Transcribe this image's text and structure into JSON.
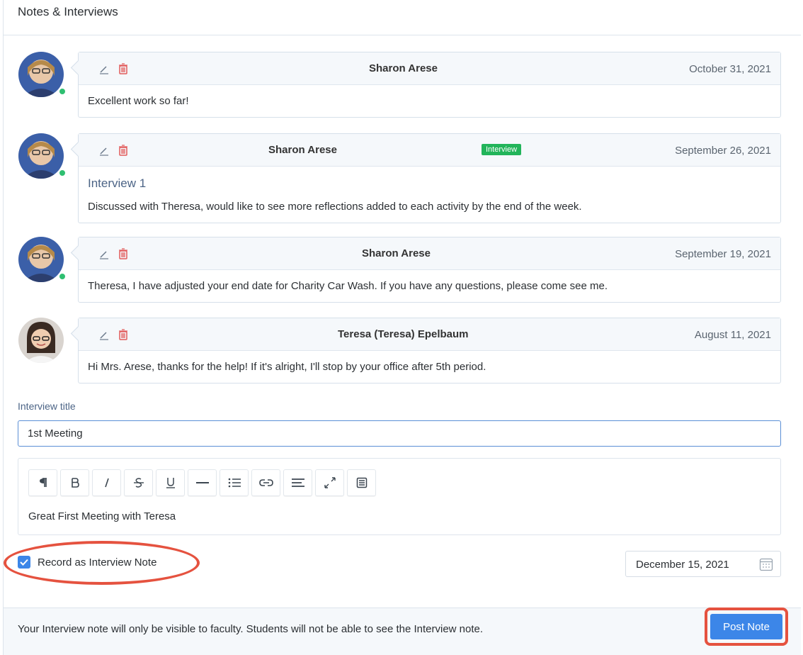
{
  "panel": {
    "title": "Notes & Interviews"
  },
  "notes": [
    {
      "author": "Sharon Arese",
      "date": "October 31, 2021",
      "badge": "",
      "subtitle": "",
      "text": "Excellent work so far!",
      "online": true,
      "avatar": "sharon"
    },
    {
      "author": "Sharon Arese",
      "date": "September 26, 2021",
      "badge": "Interview",
      "subtitle": "Interview 1",
      "text": "Discussed with Theresa, would like to see more reflections added to each activity by the end of the week.",
      "online": true,
      "avatar": "sharon"
    },
    {
      "author": "Sharon Arese",
      "date": "September 19, 2021",
      "badge": "",
      "subtitle": "",
      "text": "Theresa, I have adjusted your end date for Charity Car Wash. If you have any questions, please come see me.",
      "online": true,
      "avatar": "sharon"
    },
    {
      "author": "Teresa (Teresa) Epelbaum",
      "date": "August 11, 2021",
      "badge": "",
      "subtitle": "",
      "text": "Hi Mrs. Arese, thanks for the help! If it's alright, I'll stop by your office after 5th period.",
      "online": false,
      "avatar": "teresa"
    }
  ],
  "form": {
    "title_label": "Interview title",
    "title_value": "1st Meeting",
    "editor_text": "Great First Meeting with Teresa",
    "toolbar": [
      "paragraph-icon",
      "bold-icon",
      "italic-icon",
      "strikethrough-icon",
      "underline-icon",
      "horizontal-rule-icon",
      "list-icon",
      "link-icon",
      "align-icon",
      "fullscreen-icon",
      "source-icon"
    ],
    "checkbox_label": "Record as Interview Note",
    "checkbox_checked": true,
    "date_value": "December 15, 2021"
  },
  "footer": {
    "notice": "Your Interview note will only be visible to faculty. Students will not be able to see the Interview note.",
    "post_label": "Post Note"
  },
  "colors": {
    "accent": "#3c86e8",
    "annotation": "#e5523f",
    "badge": "#22b45a",
    "online": "#2fbf71"
  }
}
